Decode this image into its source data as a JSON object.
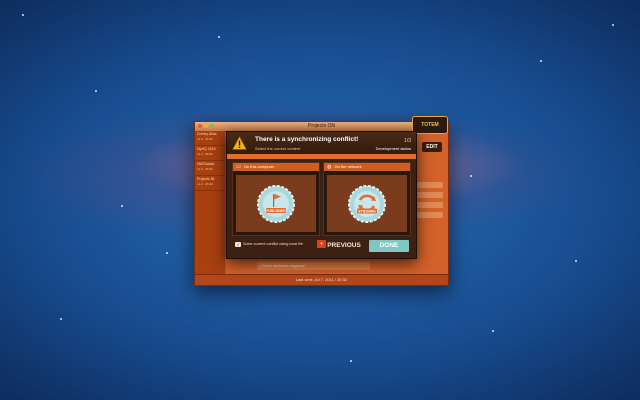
{
  "window": {
    "title": "Projects ON",
    "status": "Last sent: Jul 7, 2011 / 20:32",
    "edit_label": "EDIT",
    "logo_text": "TOTEM",
    "sidebar": [
      {
        "title": "Comey Atlas",
        "sub": "v1.4 · 06:32"
      },
      {
        "title": "MyHQ 2016",
        "sub": "v1.4 · 06:32"
      },
      {
        "title": "IWSOstatic",
        "sub": "v1.4 · 06:32"
      },
      {
        "title": "Projects 86",
        "sub": "v1.4 · 06:32"
      }
    ],
    "background_input": "• Priced freelancer magazine"
  },
  "dialog": {
    "title": "There is a synchronizing conflict!",
    "subtitle": "Select the correct content",
    "step": "1/3",
    "status_label": "Development status",
    "left_panel": {
      "header": "On this computer",
      "badge": "PUBLISHED",
      "icon": "computer-icon"
    },
    "right_panel": {
      "header": "On the network",
      "badge": "SYNCHING",
      "icon": "globe-icon"
    },
    "checkbox_label": "Solve current conflict using local file",
    "prev_label": "PREVIOUS",
    "done_label": "DONE"
  },
  "colors": {
    "accent": "#d2612a",
    "dialog_bg": "#3c2112",
    "done_button": "#7fc7c4",
    "badge": "#a9d7dc"
  }
}
